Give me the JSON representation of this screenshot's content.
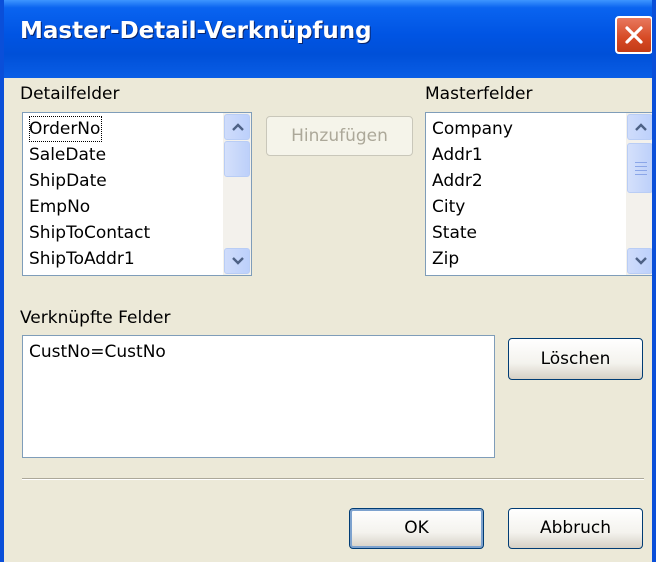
{
  "window": {
    "title": "Master-Detail-Verknüpfung"
  },
  "detail": {
    "label": "Detailfelder",
    "items": [
      "OrderNo",
      "SaleDate",
      "ShipDate",
      "EmpNo",
      "ShipToContact",
      "ShipToAddr1"
    ]
  },
  "add_button": "Hinzufügen",
  "master": {
    "label": "Masterfelder",
    "items": [
      "Company",
      "Addr1",
      "Addr2",
      "City",
      "State",
      "Zip"
    ]
  },
  "linked": {
    "label": "Verknüpfte Felder",
    "items": [
      "CustNo=CustNo"
    ]
  },
  "delete_button": "Löschen",
  "ok_button": "OK",
  "cancel_button": "Abbruch",
  "icons": {
    "close": "close-icon",
    "scroll_up": "chevron-up-icon",
    "scroll_down": "chevron-down-icon"
  },
  "colors": {
    "titlebar": "#0054e3",
    "dialog_bg": "#ece9d8",
    "close": "#d64a24"
  }
}
